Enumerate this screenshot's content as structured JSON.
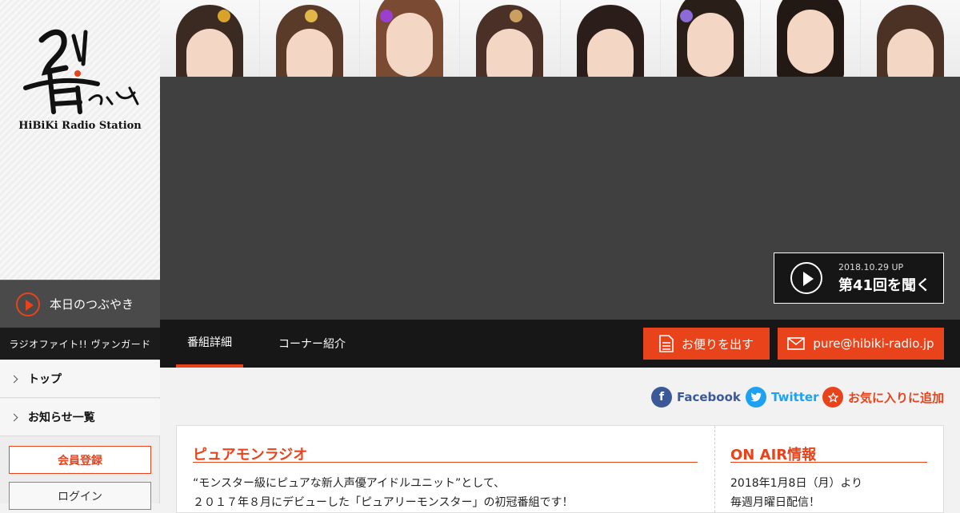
{
  "sidebar": {
    "logo_mark_alt": "響",
    "station_name": "HiBiKi Radio Station",
    "voice_button": "本日のつぶやき",
    "promo_link": "ラジオファイト!! ヴァンガード",
    "nav": [
      {
        "label": "トップ"
      },
      {
        "label": "お知らせ一覧"
      }
    ],
    "member_button": "会員登録",
    "login_button": "ログイン"
  },
  "player": {
    "date": "2018.10.29 UP",
    "listen_label": "第41回を聞く"
  },
  "tabs": [
    {
      "label": "番組詳細",
      "active": true
    },
    {
      "label": "コーナー紹介",
      "active": false
    }
  ],
  "actions": {
    "letter_button": "お便りを出す",
    "email_button": "pure@hibiki-radio.jp"
  },
  "social": {
    "facebook": "Facebook",
    "twitter": "Twitter",
    "favorite": "お気に入りに追加"
  },
  "program": {
    "title": "ピュアモンラジオ",
    "lines": [
      "“モンスター級にピュアな新人声優アイドルユニット”として、",
      "２０１７年８月にデビューした「ピュアリーモンスター」の初冠番組です！"
    ]
  },
  "onair": {
    "title": "ON AIR情報",
    "lines": [
      "2018年1月8日（月）より",
      "毎週月曜日配信！"
    ]
  },
  "colors": {
    "accent": "#e8431b",
    "facebook": "#3b5998",
    "twitter": "#1da1f2",
    "dark": "#171717",
    "player_bg": "#404040"
  }
}
